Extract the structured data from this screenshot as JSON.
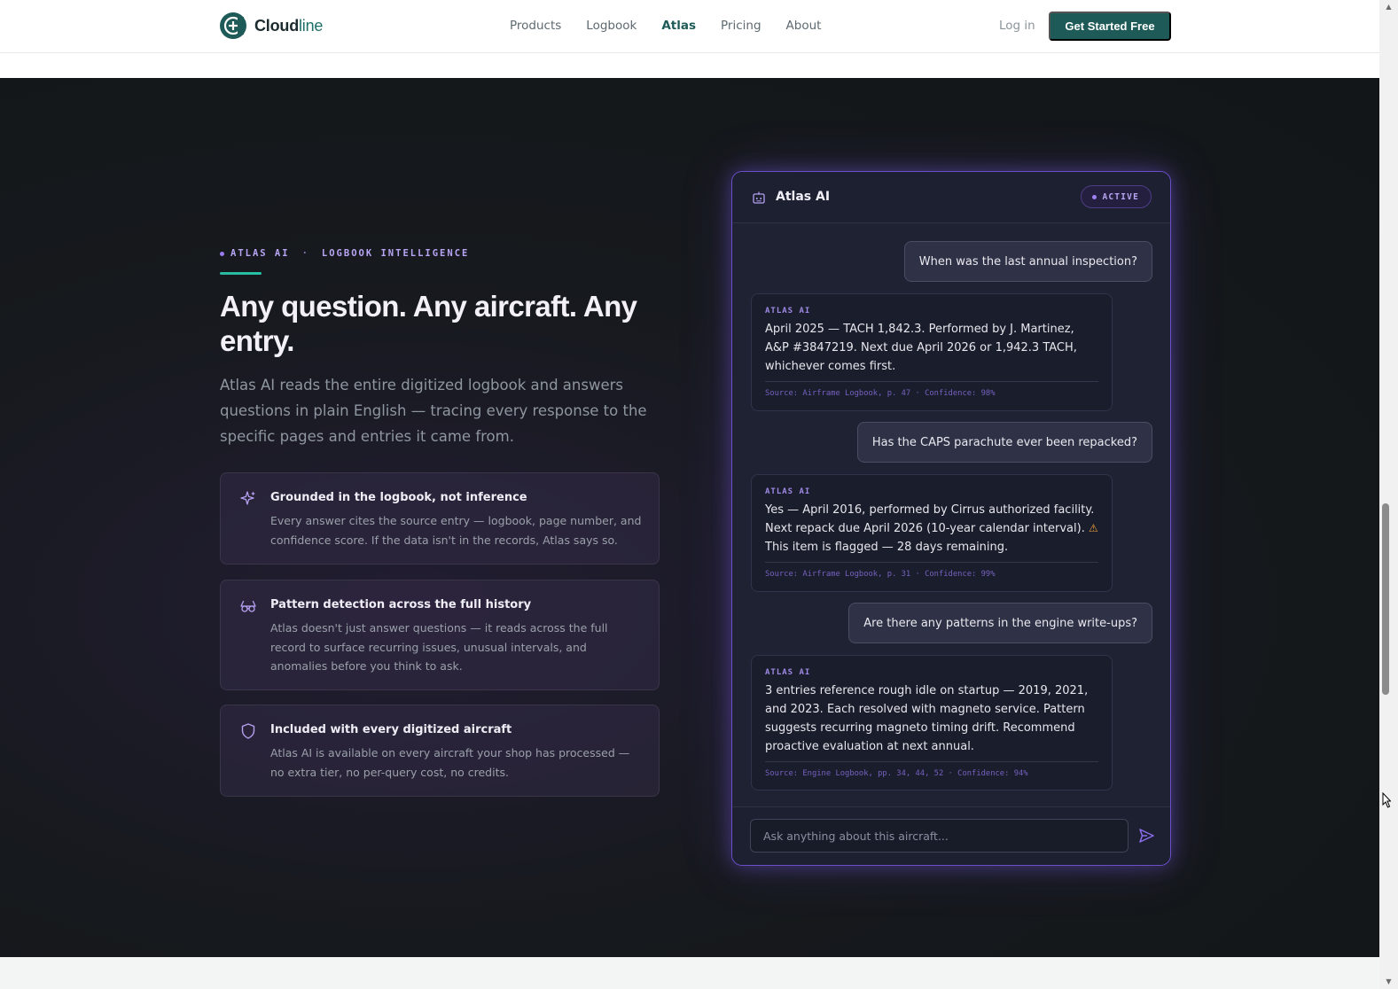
{
  "nav": {
    "brand_name": "Cloud",
    "brand_accent": "line",
    "links": [
      {
        "label": "Products",
        "active": false
      },
      {
        "label": "Logbook",
        "active": false
      },
      {
        "label": "Atlas",
        "active": true
      },
      {
        "label": "Pricing",
        "active": false
      },
      {
        "label": "About",
        "active": false
      }
    ],
    "login_label": "Log in",
    "cta_label": "Get Started Free"
  },
  "hero": {
    "eyebrow_primary": "ATLAS AI",
    "eyebrow_separator": "·",
    "eyebrow_secondary": "LOGBOOK INTELLIGENCE",
    "headline": "Any question. Any aircraft. Any entry.",
    "lede": "Atlas AI reads the entire digitized logbook and answers questions in plain English — tracing every response to the specific pages and entries it came from."
  },
  "features": [
    {
      "icon": "sparkle-icon",
      "title": "Grounded in the logbook, not inference",
      "desc": "Every answer cites the source entry — logbook, page number, and confidence score. If the data isn't in the records, Atlas says so."
    },
    {
      "icon": "glasses-icon",
      "title": "Pattern detection across the full history",
      "desc": "Atlas doesn't just answer questions — it reads across the full record to surface recurring issues, unusual intervals, and anomalies before you think to ask."
    },
    {
      "icon": "shield-icon",
      "title": "Included with every digitized aircraft",
      "desc": "Atlas AI is available on every aircraft your shop has processed — no extra tier, no per-query cost, no credits."
    }
  ],
  "chat": {
    "title": "Atlas AI",
    "status": "ACTIVE",
    "assistant_label": "ATLAS AI",
    "q1": "When was the last annual inspection?",
    "a1": "April 2025 — TACH 1,842.3. Performed by J. Martinez, A&P #3847219. Next due April 2026 or 1,942.3 TACH, whichever comes first.",
    "s1": "Source: Airframe Logbook, p. 47  ·  Confidence: 98%",
    "q2": "Has the CAPS parachute ever been repacked?",
    "a2_before": "Yes — April 2016, performed by Cirrus authorized facility. Next repack due April 2026 (10-year calendar interval).",
    "a2_after": "This item is flagged — 28 days remaining.",
    "s2": "Source: Airframe Logbook, p. 31  ·  Confidence: 99%",
    "q3": "Are there any patterns in the engine write-ups?",
    "a3": "3 entries reference rough idle on startup — 2019, 2021, and 2023. Each resolved with magneto service. Pattern suggests recurring magneto timing drift. Recommend proactive evaluation at next annual.",
    "s3": "Source: Engine Logbook, pp. 34, 44, 52  ·  Confidence: 94%",
    "input_placeholder": "Ask anything about this aircraft..."
  },
  "colors": {
    "brand": "#1e5a57",
    "accent_purple": "#9b7bf2",
    "warning": "#f0a13a",
    "dark_bg": "#16191d"
  }
}
